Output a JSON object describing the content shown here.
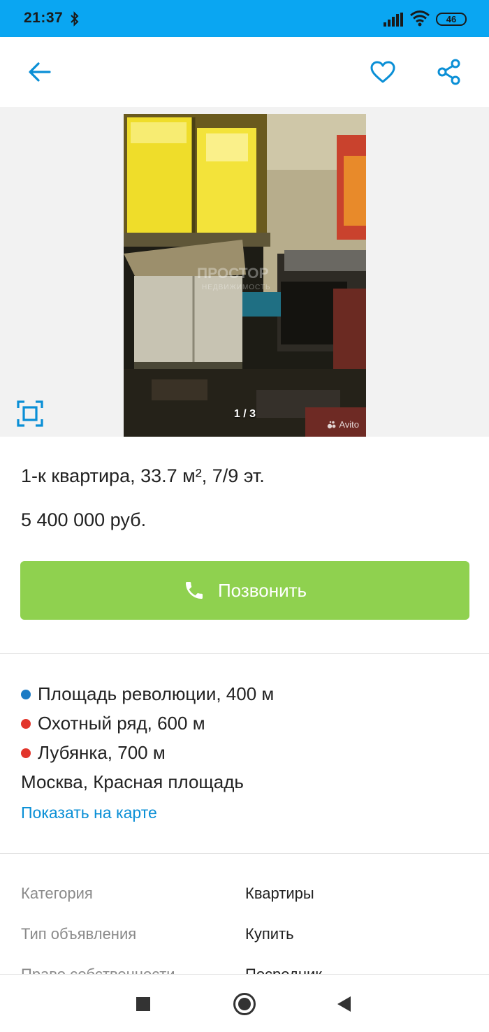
{
  "status_bar": {
    "time": "21:37",
    "battery": "46"
  },
  "listing": {
    "title": "1-к квартира, 33.7 м², 7/9 эт.",
    "price": "5 400 000 руб.",
    "call_label": "Позвонить"
  },
  "gallery": {
    "counter": "1 / 3",
    "source_mark": "Avito",
    "watermark": "ПРОСТОР",
    "watermark_sub": "НЕДВИЖИМОСТЬ"
  },
  "location": {
    "metro": [
      {
        "name": "Площадь революции, 400 м",
        "color": "#1b7bc4"
      },
      {
        "name": "Охотный ряд, 600 м",
        "color": "#e2352b"
      },
      {
        "name": "Лубянка, 700 м",
        "color": "#e2352b"
      }
    ],
    "address": "Москва, Красная площадь",
    "map_link": "Показать на карте"
  },
  "params": [
    {
      "label": "Категория",
      "value": "Квартиры"
    },
    {
      "label": "Тип объявления",
      "value": "Купить"
    },
    {
      "label": "Право собственности",
      "value": "Посредник"
    }
  ],
  "colors": {
    "status_bar": "#0aa6f2",
    "accent": "#0a8fd6",
    "call_button": "#8fd14f"
  },
  "icons": {
    "back": "arrow-left-icon",
    "favorite": "heart-icon",
    "share": "share-icon",
    "fullscreen": "fullscreen-icon",
    "call": "phone-icon"
  }
}
